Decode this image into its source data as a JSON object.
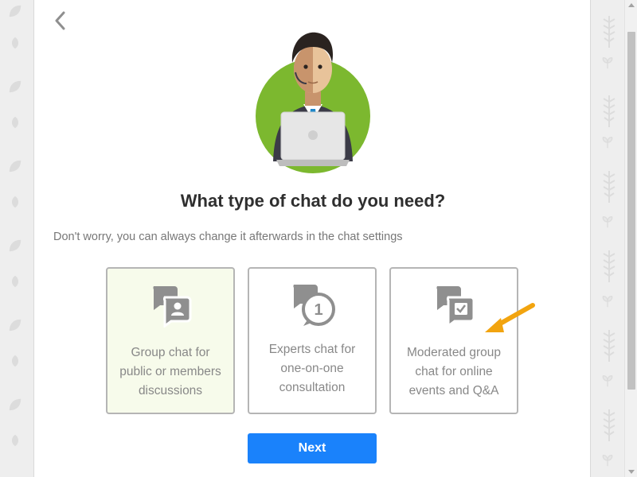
{
  "navigation": {
    "back_icon": "chevron-left-icon"
  },
  "hero": {
    "illustration": "businessman-with-laptop",
    "circle_color": "#7cb82f"
  },
  "title": "What type of chat do you need?",
  "subtitle": "Don't worry, you can always change it afterwards in the chat settings",
  "options": [
    {
      "id": "group",
      "icon": "group-chat-icon",
      "label": "Group chat for public or members discussions",
      "selected": true
    },
    {
      "id": "experts",
      "icon": "one-on-one-chat-icon",
      "label": "Experts chat for one-on-one consultation",
      "selected": false
    },
    {
      "id": "moderated",
      "icon": "moderated-chat-icon",
      "label": "Moderated group chat for online events and Q&A",
      "selected": false
    }
  ],
  "next_button": {
    "label": "Next",
    "color": "#1a82fb"
  },
  "colors": {
    "icon_gray": "#8f8f8f",
    "selected_bg": "#f7fbeb",
    "arrow": "#f2a40f",
    "text": "#2f2f2f"
  }
}
